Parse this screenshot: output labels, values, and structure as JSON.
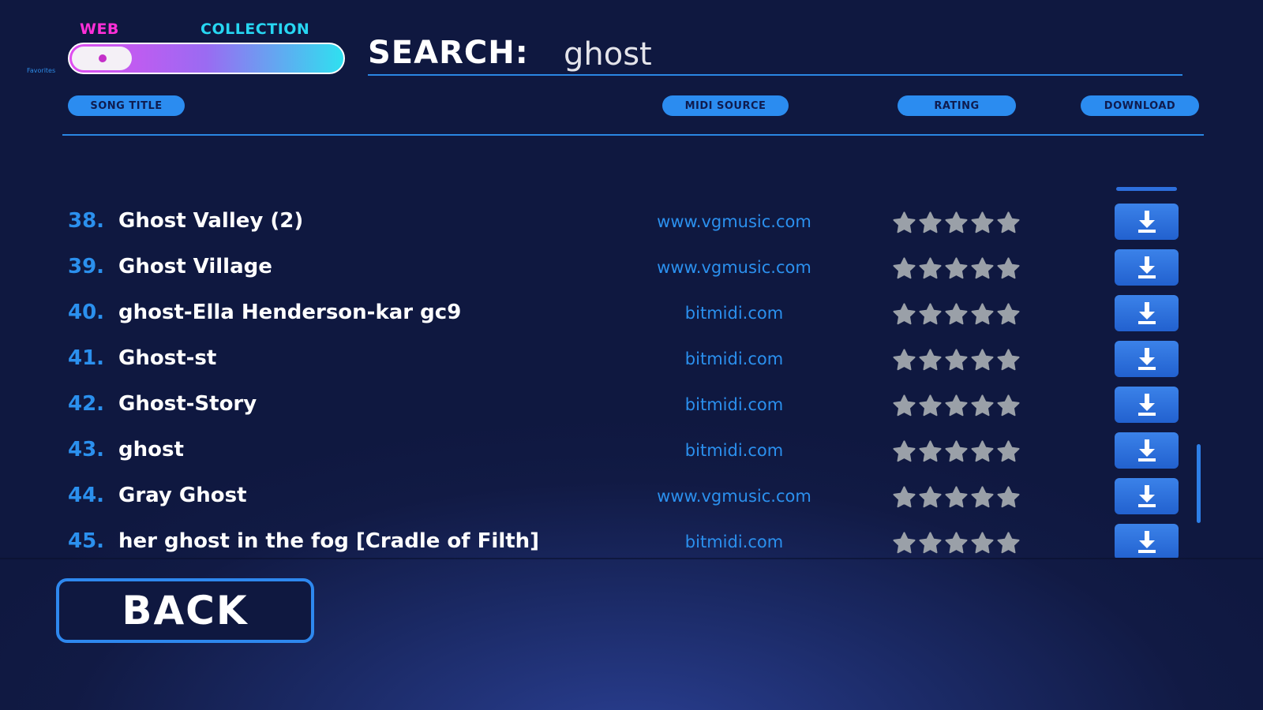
{
  "colors": {
    "web_label": "#ff2fd8",
    "collection_label": "#27d6f2",
    "toggle_gradient_start": "#e04ef0",
    "toggle_gradient_mid": "#9a6bf2",
    "toggle_gradient_end": "#2fe0f0",
    "knob_dot": "#c42fc9",
    "accent_blue": "#2b90ee",
    "pill_bg": "#2b8cf0",
    "star_gray": "#9aa0a8"
  },
  "toggle": {
    "web_label": "WEB",
    "collection_label": "COLLECTION",
    "selected": "WEB",
    "tiny_tag": "Favorites"
  },
  "search": {
    "label": "SEARCH:",
    "value": "ghost"
  },
  "columns": {
    "song_title": "SONG TITLE",
    "midi_source": "MIDI SOURCE",
    "rating": "RATING",
    "download": "DOWNLOAD"
  },
  "rows": [
    {
      "num": "38.",
      "title": "Ghost Valley (2)",
      "source": "www.vgmusic.com",
      "rating": 5,
      "download_icon": "download-icon"
    },
    {
      "num": "39.",
      "title": "Ghost Village",
      "source": "www.vgmusic.com",
      "rating": 5,
      "download_icon": "download-icon"
    },
    {
      "num": "40.",
      "title": "ghost-Ella Henderson-kar gc9",
      "source": "bitmidi.com",
      "rating": 5,
      "download_icon": "download-icon"
    },
    {
      "num": "41.",
      "title": "Ghost-st",
      "source": "bitmidi.com",
      "rating": 5,
      "download_icon": "download-icon"
    },
    {
      "num": "42.",
      "title": "Ghost-Story",
      "source": "bitmidi.com",
      "rating": 5,
      "download_icon": "download-icon"
    },
    {
      "num": "43.",
      "title": "ghost",
      "source": "bitmidi.com",
      "rating": 5,
      "download_icon": "download-icon"
    },
    {
      "num": "44.",
      "title": "Gray Ghost",
      "source": "www.vgmusic.com",
      "rating": 5,
      "download_icon": "download-icon"
    },
    {
      "num": "45.",
      "title": "her ghost in the fog [Cradle of Filth]",
      "source": "bitmidi.com",
      "rating": 5,
      "download_icon": "download-icon"
    }
  ],
  "back_button": {
    "label": "BACK"
  }
}
